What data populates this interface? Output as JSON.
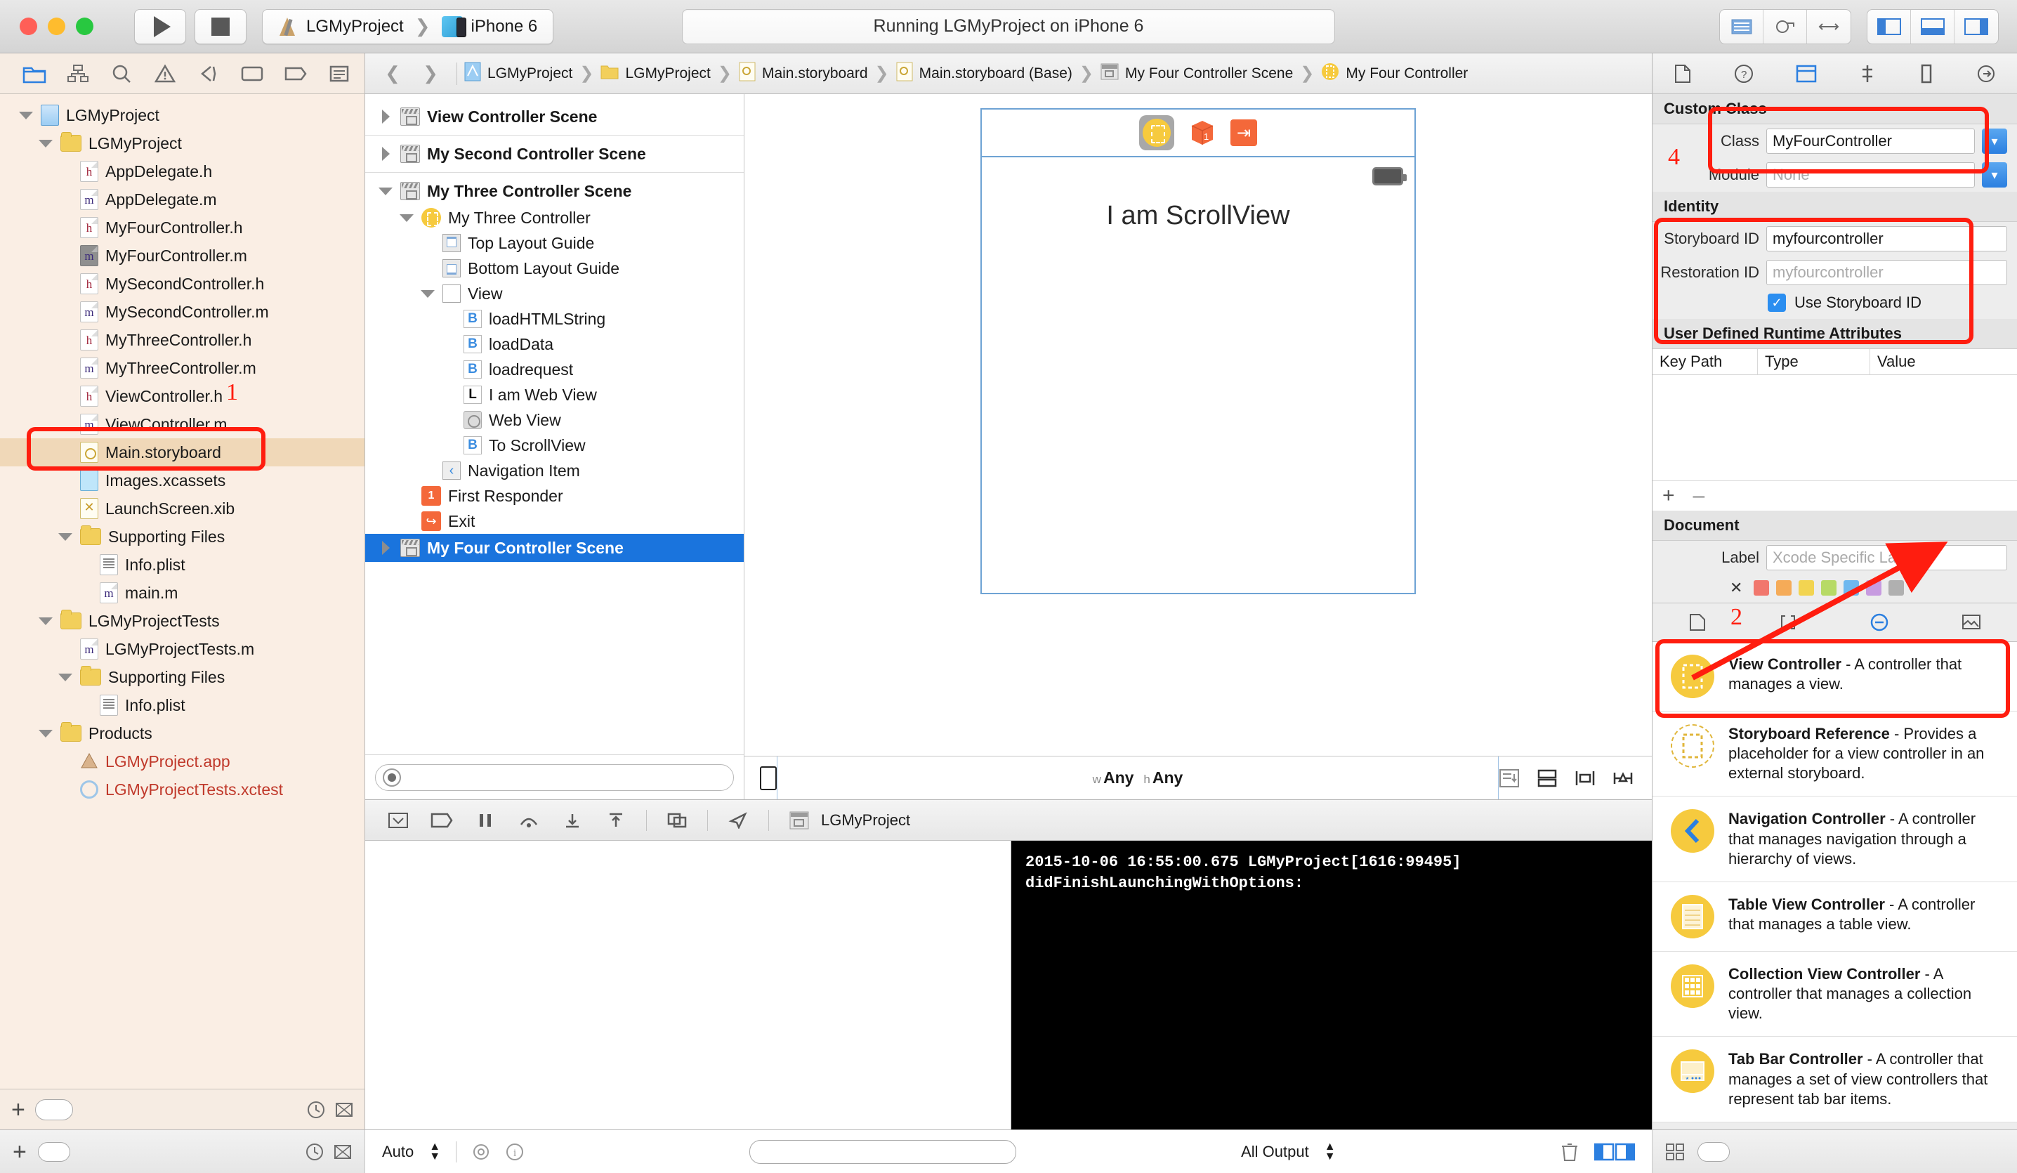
{
  "titlebar": {
    "scheme_project": "LGMyProject",
    "scheme_device": "iPhone 6",
    "status": "Running LGMyProject on iPhone 6"
  },
  "navigator": {
    "files": [
      {
        "label": "LGMyProject",
        "icon": "project-icon",
        "indent": 0,
        "twisty": "open"
      },
      {
        "label": "LGMyProject",
        "icon": "folder-icon",
        "indent": 1,
        "twisty": "open"
      },
      {
        "label": "AppDelegate.h",
        "icon": "header-file-icon",
        "indent": 2,
        "twisty": "none"
      },
      {
        "label": "AppDelegate.m",
        "icon": "impl-file-icon",
        "indent": 2,
        "twisty": "none"
      },
      {
        "label": "MyFourController.h",
        "icon": "header-file-icon",
        "indent": 2,
        "twisty": "none"
      },
      {
        "label": "MyFourController.m",
        "icon": "impl-file-icon-selected",
        "indent": 2,
        "twisty": "none"
      },
      {
        "label": "MySecondController.h",
        "icon": "header-file-icon",
        "indent": 2,
        "twisty": "none"
      },
      {
        "label": "MySecondController.m",
        "icon": "impl-file-icon",
        "indent": 2,
        "twisty": "none"
      },
      {
        "label": "MyThreeController.h",
        "icon": "header-file-icon",
        "indent": 2,
        "twisty": "none"
      },
      {
        "label": "MyThreeController.m",
        "icon": "impl-file-icon",
        "indent": 2,
        "twisty": "none"
      },
      {
        "label": "ViewController.h",
        "icon": "header-file-icon",
        "indent": 2,
        "twisty": "none"
      },
      {
        "label": "ViewController.m",
        "icon": "impl-file-icon",
        "indent": 2,
        "twisty": "none"
      },
      {
        "label": "Main.storyboard",
        "icon": "storyboard-icon",
        "indent": 2,
        "twisty": "none",
        "selected": true
      },
      {
        "label": "Images.xcassets",
        "icon": "assets-icon",
        "indent": 2,
        "twisty": "none"
      },
      {
        "label": "LaunchScreen.xib",
        "icon": "xib-icon",
        "indent": 2,
        "twisty": "none"
      },
      {
        "label": "Supporting Files",
        "icon": "folder-icon",
        "indent": 2,
        "twisty": "open"
      },
      {
        "label": "Info.plist",
        "icon": "plist-icon",
        "indent": 3,
        "twisty": "none"
      },
      {
        "label": "main.m",
        "icon": "impl-file-icon",
        "indent": 3,
        "twisty": "none"
      },
      {
        "label": "LGMyProjectTests",
        "icon": "folder-icon",
        "indent": 1,
        "twisty": "open"
      },
      {
        "label": "LGMyProjectTests.m",
        "icon": "impl-file-icon",
        "indent": 2,
        "twisty": "none"
      },
      {
        "label": "Supporting Files",
        "icon": "folder-icon",
        "indent": 2,
        "twisty": "open"
      },
      {
        "label": "Info.plist",
        "icon": "plist-icon",
        "indent": 3,
        "twisty": "none"
      },
      {
        "label": "Products",
        "icon": "folder-icon",
        "indent": 1,
        "twisty": "open"
      },
      {
        "label": "LGMyProject.app",
        "icon": "app-icon",
        "indent": 2,
        "twisty": "none",
        "red": true
      },
      {
        "label": "LGMyProjectTests.xctest",
        "icon": "xctest-icon",
        "indent": 2,
        "twisty": "none",
        "red": true
      }
    ]
  },
  "jumpbar": {
    "crumbs": [
      {
        "label": "LGMyProject",
        "icon": "project-icon"
      },
      {
        "label": "LGMyProject",
        "icon": "folder-icon"
      },
      {
        "label": "Main.storyboard",
        "icon": "storyboard-icon"
      },
      {
        "label": "Main.storyboard (Base)",
        "icon": "storyboard-icon"
      },
      {
        "label": "My Four Controller Scene",
        "icon": "scene-icon"
      },
      {
        "label": "My Four Controller",
        "icon": "view-controller-icon"
      }
    ]
  },
  "outline": {
    "rows": [
      {
        "label": "View Controller Scene",
        "icon": "scene-icon",
        "indent": 0,
        "type": "scene",
        "twisty": "closed"
      },
      {
        "sep": true
      },
      {
        "label": "My Second Controller Scene",
        "icon": "scene-icon",
        "indent": 0,
        "type": "scene",
        "twisty": "closed"
      },
      {
        "sep": true
      },
      {
        "label": "My Three Controller Scene",
        "icon": "scene-icon",
        "indent": 0,
        "type": "scene",
        "twisty": "open"
      },
      {
        "label": "My Three Controller",
        "icon": "view-controller-icon",
        "indent": 1,
        "twisty": "open"
      },
      {
        "label": "Top Layout Guide",
        "icon": "top-layout-guide-icon",
        "indent": 2,
        "twisty": "none"
      },
      {
        "label": "Bottom Layout Guide",
        "icon": "bottom-layout-guide-icon",
        "indent": 2,
        "twisty": "none"
      },
      {
        "label": "View",
        "icon": "view-icon",
        "indent": 2,
        "twisty": "open"
      },
      {
        "label": "loadHTMLString",
        "icon": "button-icon",
        "indent": 3,
        "twisty": "none"
      },
      {
        "label": "loadData",
        "icon": "button-icon",
        "indent": 3,
        "twisty": "none"
      },
      {
        "label": "loadrequest",
        "icon": "button-icon",
        "indent": 3,
        "twisty": "none"
      },
      {
        "label": "I am Web View",
        "icon": "label-icon",
        "indent": 3,
        "twisty": "none"
      },
      {
        "label": "Web View",
        "icon": "web-view-icon",
        "indent": 3,
        "twisty": "none"
      },
      {
        "label": "To ScrollView",
        "icon": "button-icon",
        "indent": 3,
        "twisty": "none"
      },
      {
        "label": "Navigation Item",
        "icon": "navigation-item-icon",
        "indent": 2,
        "twisty": "none"
      },
      {
        "label": "First Responder",
        "icon": "first-responder-icon",
        "indent": 1,
        "twisty": "none"
      },
      {
        "label": "Exit",
        "icon": "exit-icon",
        "indent": 1,
        "twisty": "none"
      },
      {
        "label": "My Four Controller Scene",
        "icon": "scene-icon",
        "indent": 0,
        "type": "scene",
        "twisty": "closed",
        "selected": true
      }
    ],
    "filter_placeholder": ""
  },
  "canvas": {
    "scroll_label": "I am ScrollView",
    "size_class_w": "Any",
    "size_class_h": "Any",
    "size_class_w_prefix": "w",
    "size_class_h_prefix": "h"
  },
  "debug": {
    "scheme_label": "LGMyProject",
    "console_lines": "2015-10-06 16:55:00.675 LGMyProject[1616:99495]\ndidFinishLaunchingWithOptions:",
    "auto_label": "Auto",
    "all_output_label": "All Output"
  },
  "inspector": {
    "custom_class": {
      "section_title": "Custom Class",
      "class_label": "Class",
      "class_value": "MyFourController",
      "module_label": "Module",
      "module_placeholder": "None"
    },
    "identity": {
      "section_title": "Identity",
      "storyboard_id_label": "Storyboard ID",
      "storyboard_id_value": "myfourcontroller",
      "restoration_id_label": "Restoration ID",
      "restoration_id_placeholder": "myfourcontroller",
      "use_storyboard_id_label": "Use Storyboard ID",
      "use_storyboard_id_checked": true
    },
    "runtime_attributes": {
      "section_title": "User Defined Runtime Attributes",
      "columns": [
        "Key Path",
        "Type",
        "Value"
      ],
      "rows": [],
      "add_label": "+",
      "remove_label": "–"
    },
    "document": {
      "section_title": "Document",
      "label_label": "Label",
      "label_placeholder": "Xcode Specific Label",
      "swatch_colors": [
        "#f1776d",
        "#f5ab58",
        "#f2d451",
        "#b7da66",
        "#6fb8ef",
        "#c79be0",
        "#b0b0b0"
      ],
      "clear_label": "✕"
    },
    "library": [
      {
        "title": "View Controller",
        "desc": " - A controller that manages a view.",
        "icon": "view-controller-icon",
        "highlighted": true
      },
      {
        "title": "Storyboard Reference",
        "desc": " - Provides a placeholder for a view controller in an external storyboard.",
        "icon": "storyboard-reference-icon"
      },
      {
        "title": "Navigation Controller",
        "desc": " - A controller that manages navigation through a hierarchy of views.",
        "icon": "navigation-controller-icon"
      },
      {
        "title": "Table View Controller",
        "desc": " - A controller that manages a table view.",
        "icon": "table-view-controller-icon"
      },
      {
        "title": "Collection View Controller",
        "desc": " - A controller that manages a collection view.",
        "icon": "collection-view-controller-icon"
      },
      {
        "title": "Tab Bar Controller",
        "desc": " - A controller that manages a set of view controllers that represent tab bar items.",
        "icon": "tab-bar-controller-icon"
      }
    ]
  },
  "annotations": {
    "n1": "1",
    "n2": "2",
    "n4": "4",
    "accent_color": "#ff1d0f"
  }
}
